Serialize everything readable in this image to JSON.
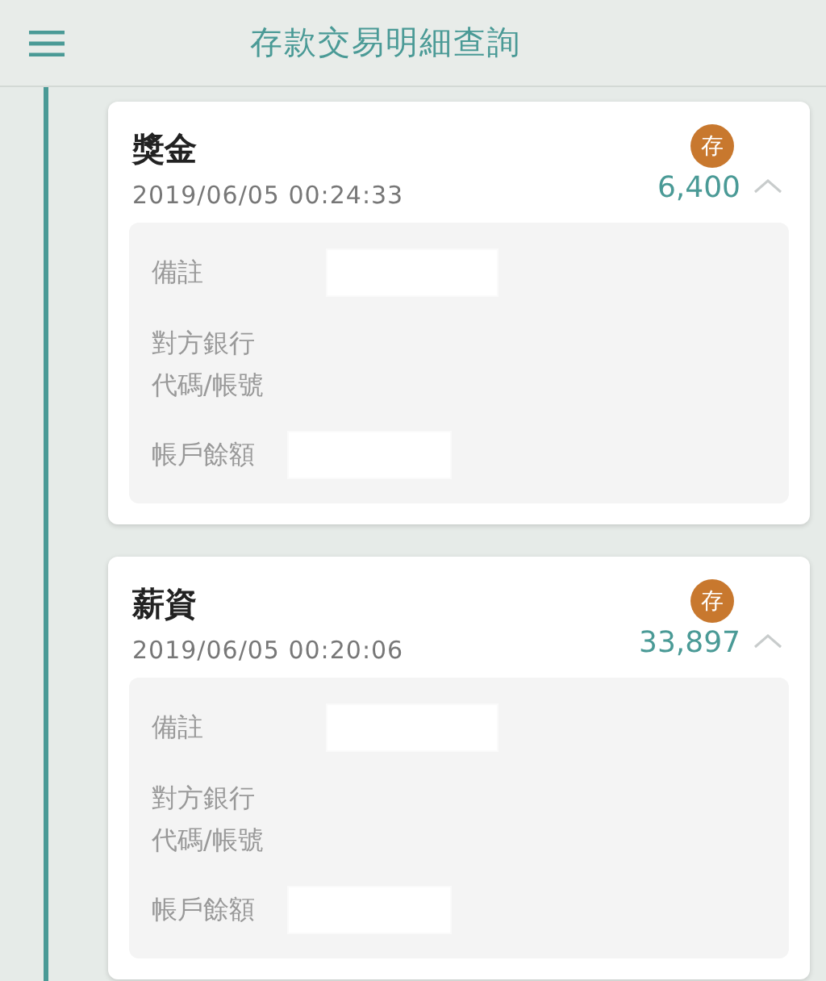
{
  "header": {
    "title": "存款交易明細查詢"
  },
  "transactions": [
    {
      "title": "獎金",
      "datetime": "2019/06/05 00:24:33",
      "badge": "存",
      "amount": "6,400",
      "expanded": true,
      "details": [
        {
          "label": "備註",
          "value_hidden": true
        },
        {
          "label": "對方銀行代碼/帳號",
          "value_hidden": false
        },
        {
          "label": "帳戶餘額",
          "value_hidden": true
        }
      ]
    },
    {
      "title": "薪資",
      "datetime": "2019/06/05 00:20:06",
      "badge": "存",
      "amount": "33,897",
      "expanded": true,
      "details": [
        {
          "label": "備註",
          "value_hidden": true
        },
        {
          "label": "對方銀行代碼/帳號",
          "value_hidden": false
        },
        {
          "label": "帳戶餘額",
          "value_hidden": true
        }
      ]
    }
  ]
}
